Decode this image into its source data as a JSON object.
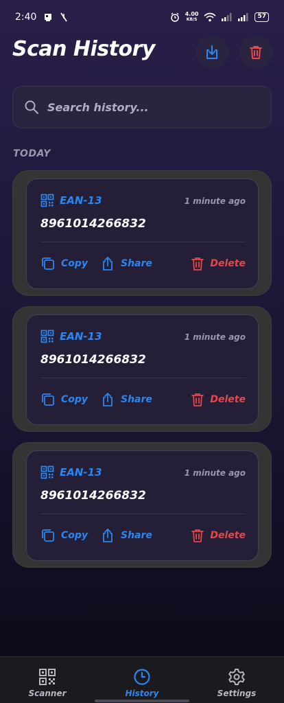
{
  "status_bar": {
    "time": "2:40",
    "net_speed": "4.00",
    "net_unit": "KB/S",
    "battery": "57"
  },
  "header": {
    "title": "Scan History",
    "export_icon": "download-icon",
    "clear_icon": "trash-icon"
  },
  "search": {
    "placeholder": "Search history...",
    "value": ""
  },
  "section": {
    "label": "TODAY"
  },
  "history": [
    {
      "type": "EAN-13",
      "time": "1 minute ago",
      "value": "8961014266832",
      "copy_label": "Copy",
      "share_label": "Share",
      "delete_label": "Delete"
    },
    {
      "type": "EAN-13",
      "time": "1 minute ago",
      "value": "8961014266832",
      "copy_label": "Copy",
      "share_label": "Share",
      "delete_label": "Delete"
    },
    {
      "type": "EAN-13",
      "time": "1 minute ago",
      "value": "8961014266832",
      "copy_label": "Copy",
      "share_label": "Share",
      "delete_label": "Delete"
    }
  ],
  "nav": {
    "items": [
      {
        "label": "Scanner",
        "icon": "qr-code-icon",
        "active": false
      },
      {
        "label": "History",
        "icon": "clock-icon",
        "active": true
      },
      {
        "label": "Settings",
        "icon": "gear-icon",
        "active": false
      }
    ]
  },
  "colors": {
    "accent": "#2a86f0",
    "danger": "#e8464a",
    "background_top": "#2a1e48",
    "background_bottom": "#0a0a14"
  }
}
